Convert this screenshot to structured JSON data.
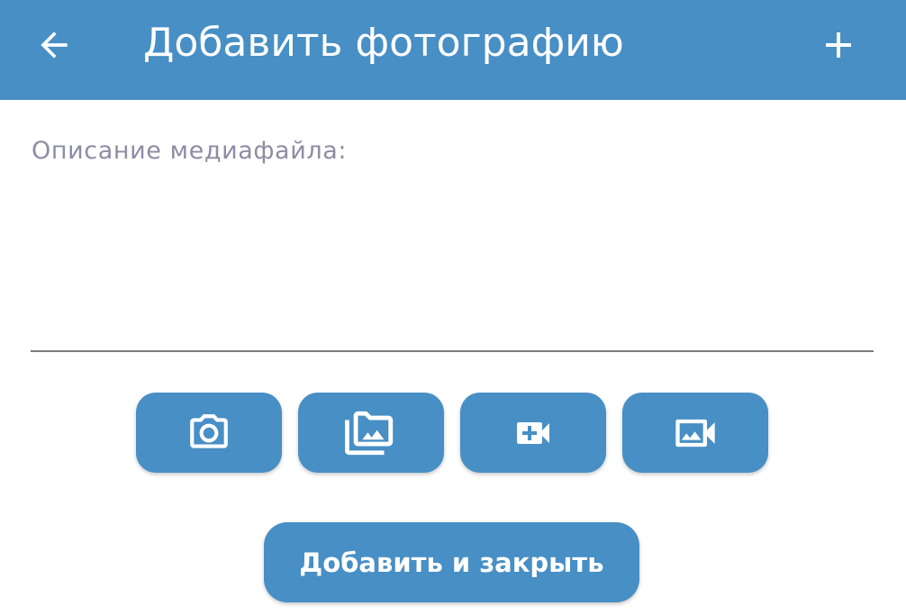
{
  "header": {
    "title": "Добавить фотографию",
    "back_icon": "arrow-left-icon",
    "add_icon": "plus-icon"
  },
  "form": {
    "description_label": "Описание медиафайла:",
    "description_value": ""
  },
  "media_actions": [
    {
      "icon": "camera-icon"
    },
    {
      "icon": "photo-library-icon"
    },
    {
      "icon": "video-add-icon"
    },
    {
      "icon": "video-library-icon"
    }
  ],
  "submit": {
    "label": "Добавить и закрыть"
  },
  "colors": {
    "primary": "#478fc5",
    "label": "#8d8da3",
    "underline": "#7a7a7a",
    "on_primary": "#ffffff"
  }
}
